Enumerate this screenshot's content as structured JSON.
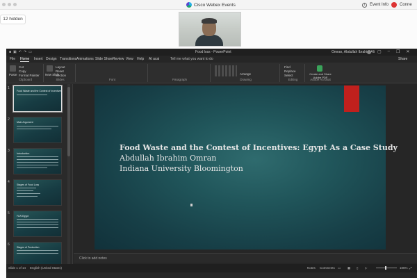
{
  "webex": {
    "title": "Cisco Webex Events",
    "event_info": "Event Info",
    "connect": "Conne",
    "hidden_count": "12 hidden"
  },
  "ppt": {
    "doc_title": "Food loss - PowerPoint",
    "user": "Omran, Abdullah Ibrahim Ali",
    "tabs": [
      "File",
      "Home",
      "Insert",
      "Design",
      "Transitions",
      "Animations",
      "Slide Show",
      "Review",
      "View",
      "Help",
      "AI acai"
    ],
    "tell_me": "Tell me what you want to do",
    "share": "Share",
    "ribbon": {
      "paste": "Paste",
      "cut": "Cut",
      "copy": "Copy",
      "format_painter": "Format Painter",
      "clipboard": "Clipboard",
      "new_slide": "New Slide",
      "layout": "Layout",
      "reset": "Reset",
      "section": "Section",
      "slides": "Slides",
      "font": "Font",
      "paragraph": "Paragraph",
      "arrange": "Arrange",
      "drawing": "Drawing",
      "find": "Find",
      "replace": "Replace",
      "select": "Select",
      "editing": "Editing",
      "create_share": "Create and Share Adobe PDF",
      "adobe": "Adobe Acrobat"
    },
    "thumbnails": [
      {
        "num": "1",
        "title": "Food Waste and the Contest of Incentives"
      },
      {
        "num": "2",
        "title": "Main Argument"
      },
      {
        "num": "3",
        "title": "Introduction"
      },
      {
        "num": "4",
        "title": "Stages of Food Loss"
      },
      {
        "num": "5",
        "title": "FLW Egypt"
      },
      {
        "num": "6",
        "title": "Stages of Production"
      }
    ],
    "slide": {
      "title": "Food Waste and the Contest of Incentives: Egypt As a Case Study",
      "author": "Abdullah Ibrahim Omran",
      "affiliation": "Indiana University Bloomington"
    },
    "notes_placeholder": "Click to add notes",
    "status": {
      "slide_counter": "Slide 1 of 14",
      "language": "English (United States)",
      "notes": "Notes",
      "comments": "Comments",
      "zoom": "106%"
    }
  }
}
